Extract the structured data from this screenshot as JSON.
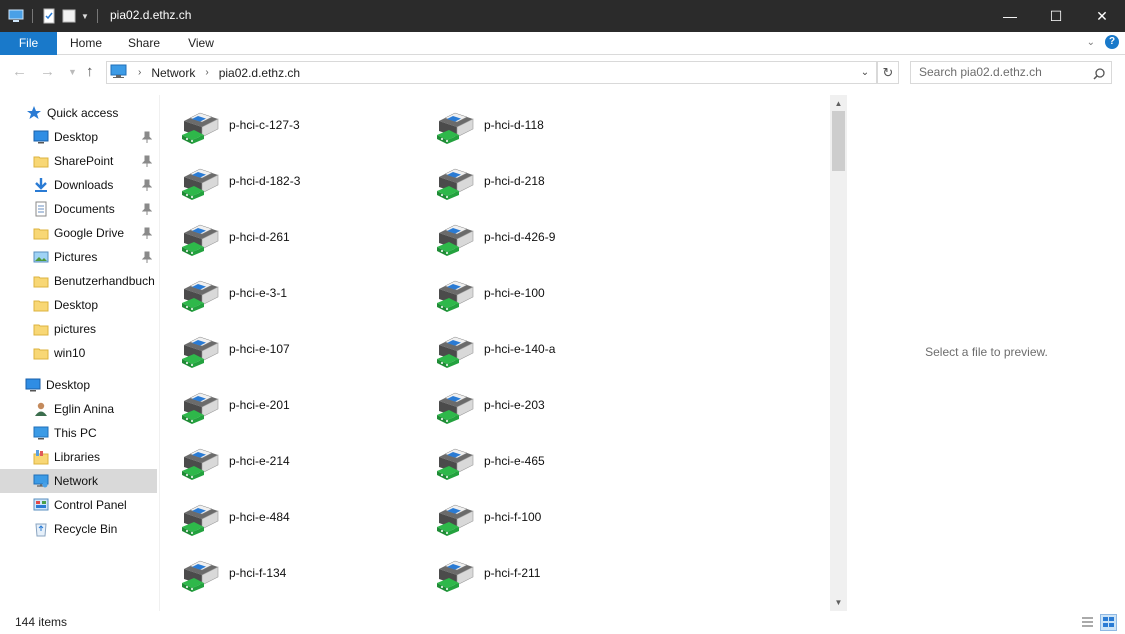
{
  "window": {
    "title": "pia02.d.ethz.ch",
    "minimize_glyph": "—",
    "maximize_glyph": "☐",
    "close_glyph": "✕"
  },
  "ribbon": {
    "tabs": [
      {
        "label": "File"
      },
      {
        "label": "Home"
      },
      {
        "label": "Share"
      },
      {
        "label": "View"
      }
    ]
  },
  "address": {
    "crumbs": [
      "Network",
      "pia02.d.ethz.ch"
    ],
    "search_placeholder": "Search pia02.d.ethz.ch"
  },
  "nav_pane": {
    "quick_access": "Quick access",
    "items": [
      {
        "label": "Desktop",
        "icon": "desktop-icon",
        "pinned": true
      },
      {
        "label": "SharePoint",
        "icon": "folder-icon",
        "pinned": true
      },
      {
        "label": "Downloads",
        "icon": "download-icon",
        "pinned": true
      },
      {
        "label": "Documents",
        "icon": "documents-icon",
        "pinned": true
      },
      {
        "label": "Google Drive",
        "icon": "folder-icon",
        "pinned": true
      },
      {
        "label": "Pictures",
        "icon": "pictures-icon",
        "pinned": true
      },
      {
        "label": "Benutzerhandbuch",
        "icon": "folder-icon",
        "pinned": false
      },
      {
        "label": "Desktop",
        "icon": "folder-icon",
        "pinned": false
      },
      {
        "label": "pictures",
        "icon": "folder-icon",
        "pinned": false
      },
      {
        "label": "win10",
        "icon": "folder-icon",
        "pinned": false
      }
    ],
    "desktop_root": "Desktop",
    "desktop_children": [
      {
        "label": "Eglin  Anina",
        "icon": "user-icon"
      },
      {
        "label": "This PC",
        "icon": "this-pc-icon"
      },
      {
        "label": "Libraries",
        "icon": "libraries-icon"
      },
      {
        "label": "Network",
        "icon": "network-icon",
        "selected": true
      },
      {
        "label": "Control Panel",
        "icon": "control-panel-icon"
      },
      {
        "label": "Recycle Bin",
        "icon": "recycle-bin-icon"
      }
    ]
  },
  "printers": [
    "p-hci-c-127-3",
    "p-hci-d-118",
    "p-hci-d-182-3",
    "p-hci-d-218",
    "p-hci-d-261",
    "p-hci-d-426-9",
    "p-hci-e-3-1",
    "p-hci-e-100",
    "p-hci-e-107",
    "p-hci-e-140-a",
    "p-hci-e-201",
    "p-hci-e-203",
    "p-hci-e-214",
    "p-hci-e-465",
    "p-hci-e-484",
    "p-hci-f-100",
    "p-hci-f-134",
    "p-hci-f-211"
  ],
  "preview": {
    "message": "Select a file to preview."
  },
  "status": {
    "item_count": "144 items"
  }
}
